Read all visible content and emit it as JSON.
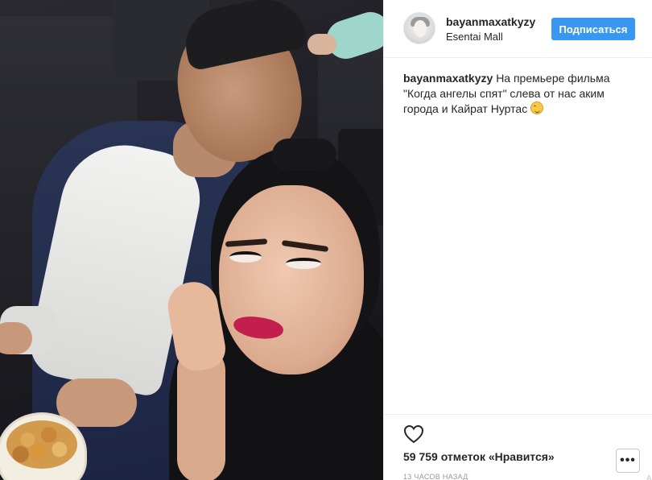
{
  "post": {
    "photo": {
      "description_icon": "post-photo"
    },
    "header": {
      "username": "bayanmaxatkyzy",
      "location": "Esentai Mall",
      "follow_label": "Подписаться",
      "follow_color": "#3897f0"
    },
    "caption": {
      "username": "bayanmaxatkyzy",
      "text": "На премьере фильма \"Когда ангелы спят\" слева от нас аким города и Кайрат Нуртас",
      "emoji": "smiling-face-emoji"
    },
    "actions": {
      "like_icon": "heart-icon",
      "likes": "59 759 отметок «Нравится»",
      "time": "13 часов назад",
      "more_label": "•••",
      "truncated_text": "А"
    }
  }
}
